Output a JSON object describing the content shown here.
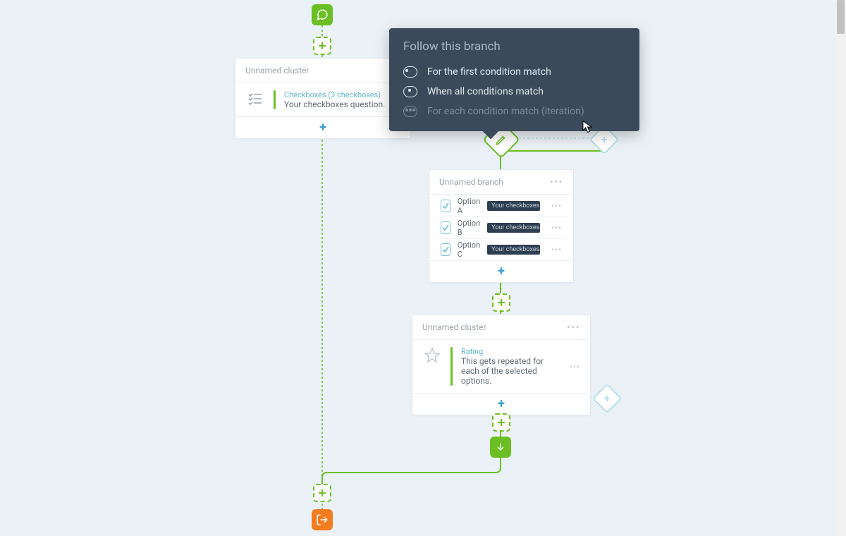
{
  "start": {
    "name": "conversation-start"
  },
  "cluster1": {
    "title": "Unnamed cluster",
    "meta": "Checkboxes (3 checkboxes)",
    "desc": "Your checkboxes question."
  },
  "tooltip": {
    "heading": "Follow this branch",
    "options": [
      "For the first condition match",
      "When all conditions match",
      "For each condition match (iteration)"
    ]
  },
  "branch": {
    "title": "Unnamed branch",
    "pill": "Your checkboxes que",
    "rows": [
      "Option A",
      "Option B",
      "Option C"
    ]
  },
  "cluster2": {
    "title": "Unnamed cluster",
    "meta": "Rating",
    "desc": "This gets repeated for each of the selected options."
  },
  "plus": "+",
  "more": "•••"
}
